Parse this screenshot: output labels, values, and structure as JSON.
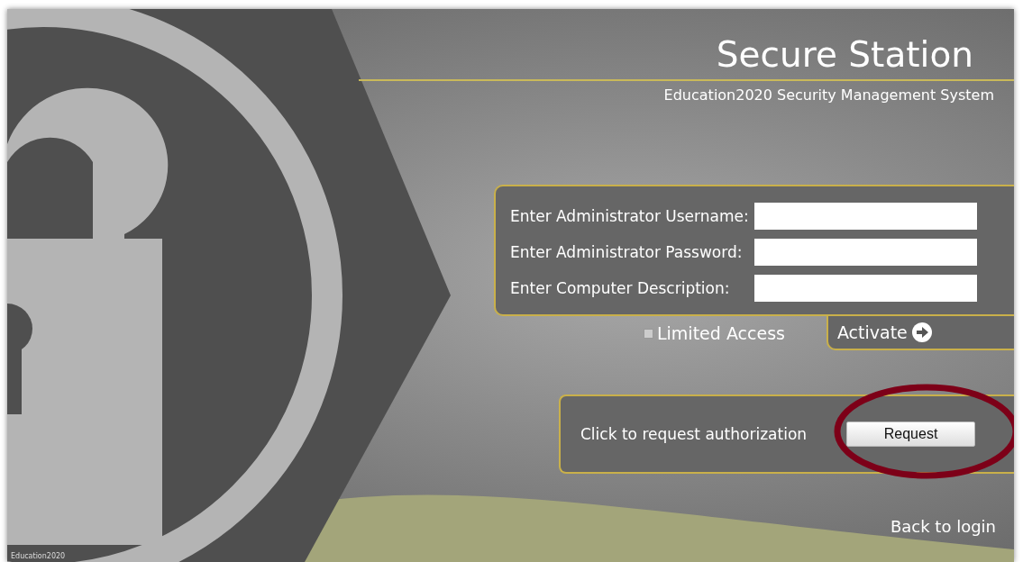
{
  "header": {
    "title": "Secure Station",
    "subtitle": "Education2020 Security Management System"
  },
  "fields": [
    {
      "label": "Enter Administrator Username:"
    },
    {
      "label": "Enter Administrator Password:"
    },
    {
      "label": "Enter Computer Description:"
    }
  ],
  "limited_access": {
    "label": "Limited Access",
    "checked": false
  },
  "activate": {
    "label": "Activate"
  },
  "request": {
    "prompt": "Click to request authorization",
    "button": "Request"
  },
  "back_link": "Back to login",
  "footer": "Education2020"
}
